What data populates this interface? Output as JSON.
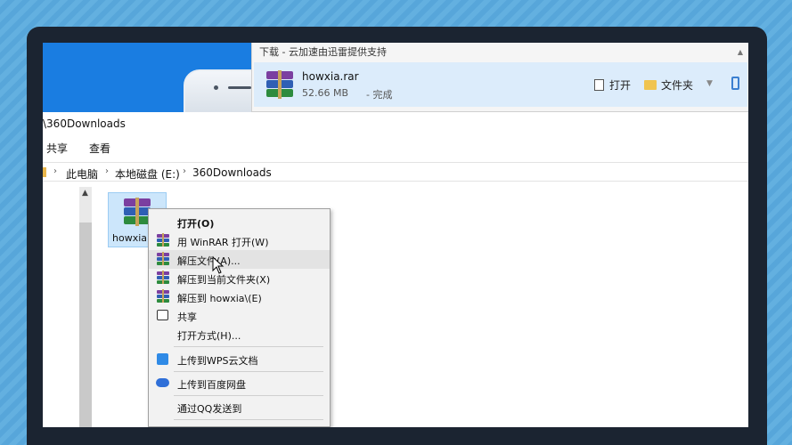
{
  "colors": {
    "accent_blue": "#1a7de1",
    "selection": "#cce6fb",
    "download_row": "#dcecfb"
  },
  "explorer": {
    "window_title": "\\360Downloads",
    "ribbon": [
      "共享",
      "查看"
    ],
    "breadcrumb": [
      "此电脑",
      "本地磁盘 (E:)",
      "360Downloads"
    ],
    "file_label": "howxia.r"
  },
  "download_bar": {
    "title": "下载 - 云加速由迅雷提供支持",
    "file_name": "howxia.rar",
    "size": "52.66 MB",
    "status": "- 完成",
    "open_label": "打开",
    "folder_label": "文件夹"
  },
  "context_menu": {
    "items": [
      {
        "label": "打开(O)",
        "icon": "none"
      },
      {
        "label": "用 WinRAR 打开(W)",
        "icon": "winrar-icon"
      },
      {
        "label": "解压文件(A)...",
        "icon": "winrar-icon"
      },
      {
        "label": "解压到当前文件夹(X)",
        "icon": "winrar-icon"
      },
      {
        "label": "解压到 howxia\\(E)",
        "icon": "winrar-icon"
      },
      {
        "label": "共享",
        "icon": "share-icon"
      },
      {
        "label": "打开方式(H)...",
        "icon": "none"
      },
      {
        "label": "上传到WPS云文档",
        "icon": "wps-cloud-icon"
      },
      {
        "label": "上传到百度网盘",
        "icon": "baidu-netdisk-icon"
      },
      {
        "label": "通过QQ发送到",
        "icon": "none"
      }
    ]
  }
}
